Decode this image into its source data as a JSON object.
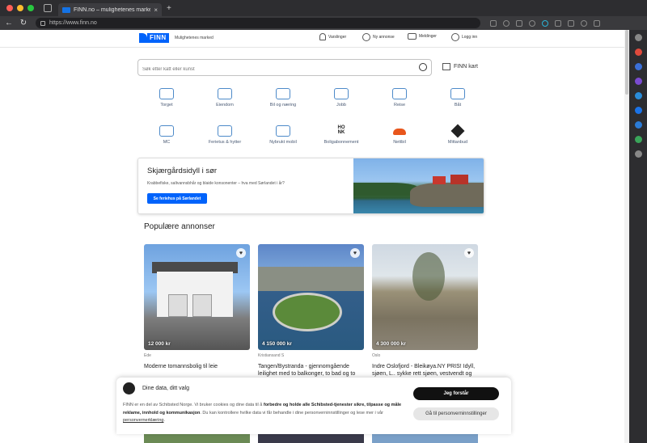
{
  "browser": {
    "tab_title": "FINN.no – mulighetenes marke",
    "url": "https://www.finn.no"
  },
  "header": {
    "logo_text": "FINN",
    "tagline": "Mulighetenes marked",
    "nav": {
      "varslinger": "Varslinger",
      "ny_annonse": "Ny annonse",
      "meldinger": "Meldinger",
      "logg_inn": "Logg inn"
    }
  },
  "search": {
    "placeholder": "Søk etter katt eller kunst",
    "map_link": "FINN kart"
  },
  "categories": [
    {
      "label": "Torget",
      "icon": "sofa-icon"
    },
    {
      "label": "Eiendom",
      "icon": "house-icon"
    },
    {
      "label": "Bil og næring",
      "icon": "car-icon"
    },
    {
      "label": "Jobb",
      "icon": "briefcase-icon"
    },
    {
      "label": "Reise",
      "icon": "plane-icon"
    },
    {
      "label": "Båt",
      "icon": "boat-icon"
    },
    {
      "label": "MC",
      "icon": "motorcycle-icon"
    },
    {
      "label": "Ferietus & hytter",
      "icon": "cabin-icon"
    },
    {
      "label": "Nybrukt mobil",
      "icon": "phone-icon"
    },
    {
      "label": "Boligabonnement",
      "icon": "honk-logo-icon",
      "logo_text": "HO\nNK"
    },
    {
      "label": "Nettbil",
      "icon": "nettbil-logo-icon"
    },
    {
      "label": "Mittanbud",
      "icon": "mittanbud-logo-icon"
    }
  ],
  "promo": {
    "title": "Skjærgårdsidyll i sør",
    "subtitle": "Krabbefiske, saltvannsbhår og blaide konsonenter – hva med Sørlandet i år?",
    "button": "Se feriehus på Sørlandet"
  },
  "popular": {
    "heading": "Populære annonser",
    "ads": [
      {
        "price": "12 000 kr",
        "location": "Ede",
        "title": "Moderne tomannsbolig til leie"
      },
      {
        "price": "4 150 000 kr",
        "location": "Kristiansand S",
        "title": "Tangen/Bystranda - gjennomgående leilighet med to balkonger, to bad og to"
      },
      {
        "price": "4 300 000 kr",
        "location": "Oslo",
        "title": "Indre Oslofjord - Bleikøya.NY PRIS! Idyll, sjøen, L.. sykke rett sjøen, vestvendt og"
      }
    ]
  },
  "cookie": {
    "title": "Dine data, ditt valg",
    "text_pre": "FINN er en del av Schibsted Norge. Vi bruker cookies og dine data til å ",
    "text_bold": "forbedre og holde alle Schibsted-tjenester sikre, tilpasse og måle reklame, innhold og kommunikasjon",
    "text_mid": ". Du kan kontrollere hvilke data vi får behandle i dine personverninnstillinger og lese mer i vår ",
    "text_link": "personvernerklæring",
    "text_end": ".",
    "accept": "Jeg forstår",
    "settings": "Gå til personverninnstillinger"
  },
  "colors": {
    "brand": "#0063fb",
    "category_icon": "#4d8ac9"
  }
}
